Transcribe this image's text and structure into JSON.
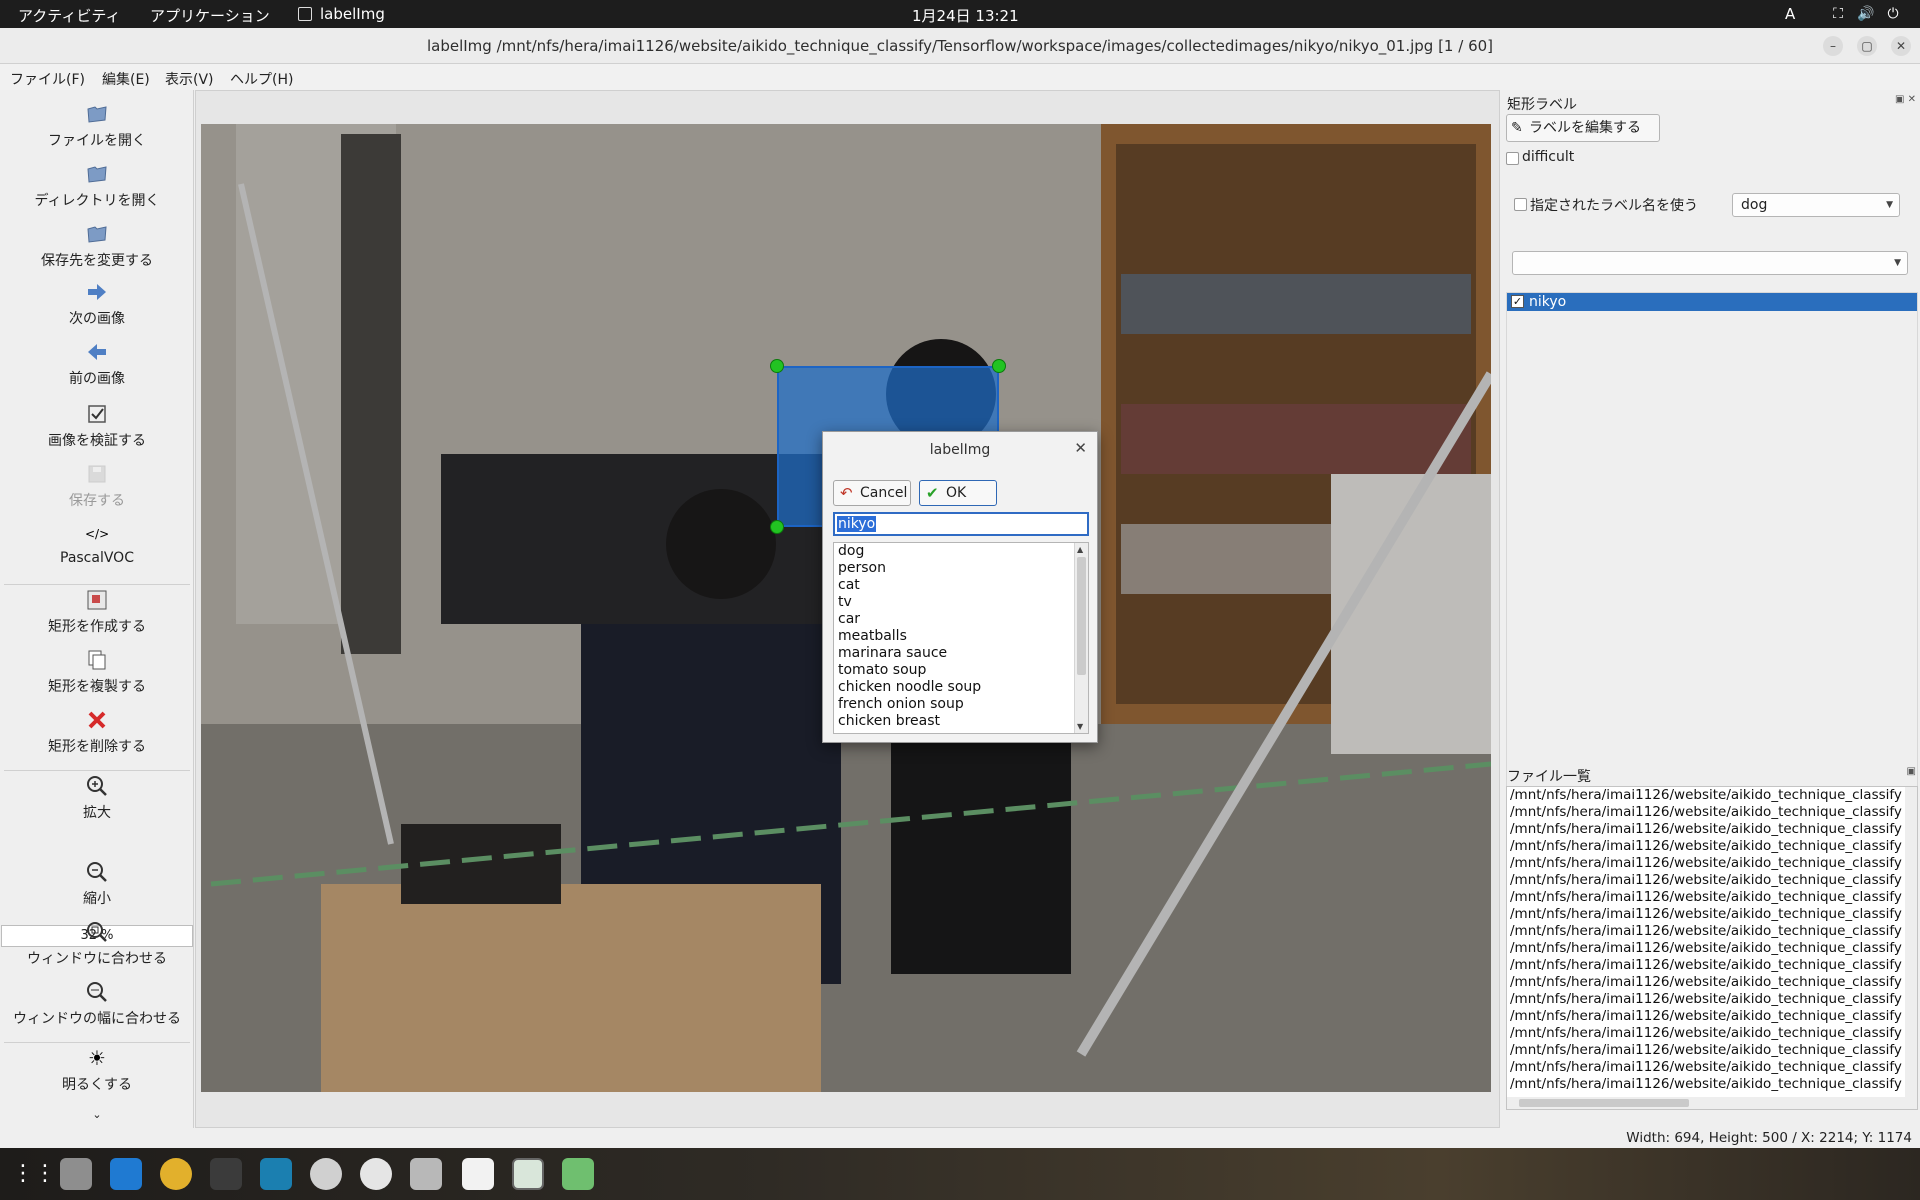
{
  "topbar": {
    "activities": "アクティビティ",
    "applications": "アプリケーション",
    "app_name": "labelImg",
    "clock": "1月24日  13:21",
    "input_method": "A"
  },
  "window": {
    "title": "labelImg /mnt/nfs/hera/imai1126/website/aikido_technique_classify/Tensorflow/workspace/images/collectedimages/nikyo/nikyo_01.jpg [1 / 60]"
  },
  "menu": {
    "file": "ファイル(F)",
    "edit": "編集(E)",
    "view": "表示(V)",
    "help": "ヘルプ(H)"
  },
  "toolbar": {
    "open_file": "ファイルを開く",
    "open_dir": "ディレクトリを開く",
    "change_save_dir": "保存先を変更する",
    "next_image": "次の画像",
    "prev_image": "前の画像",
    "verify_image": "画像を検証する",
    "save": "保存する",
    "format": "PascalVOC",
    "create_rect": "矩形を作成する",
    "duplicate_rect": "矩形を複製する",
    "delete_rect": "矩形を削除する",
    "zoom_in": "拡大",
    "zoom_level": "32 %",
    "zoom_out": "縮小",
    "fit_window": "ウィンドウに合わせる",
    "fit_width": "ウィンドウの幅に合わせる",
    "brighten": "明るくする",
    "more": "⌄"
  },
  "dialog": {
    "title": "labelImg",
    "cancel": "Cancel",
    "ok": "OK",
    "input_value": "nikyo",
    "options": [
      "dog",
      "person",
      "cat",
      "tv",
      "car",
      "meatballs",
      "marinara sauce",
      "tomato soup",
      "chicken noodle soup",
      "french onion soup",
      "chicken breast"
    ]
  },
  "dock": {
    "box_labels_title": "矩形ラベル",
    "edit_label": "ラベルを編集する",
    "difficult": "difficult",
    "use_default_label": "指定されたラベル名を使う",
    "default_label_value": "dog",
    "labels": [
      {
        "name": "nikyo",
        "checked": true
      }
    ],
    "file_list_title": "ファイル一覧",
    "files": [
      "/mnt/nfs/hera/imai1126/website/aikido_technique_classify",
      "/mnt/nfs/hera/imai1126/website/aikido_technique_classify",
      "/mnt/nfs/hera/imai1126/website/aikido_technique_classify",
      "/mnt/nfs/hera/imai1126/website/aikido_technique_classify",
      "/mnt/nfs/hera/imai1126/website/aikido_technique_classify",
      "/mnt/nfs/hera/imai1126/website/aikido_technique_classify",
      "/mnt/nfs/hera/imai1126/website/aikido_technique_classify",
      "/mnt/nfs/hera/imai1126/website/aikido_technique_classify",
      "/mnt/nfs/hera/imai1126/website/aikido_technique_classify",
      "/mnt/nfs/hera/imai1126/website/aikido_technique_classify",
      "/mnt/nfs/hera/imai1126/website/aikido_technique_classify",
      "/mnt/nfs/hera/imai1126/website/aikido_technique_classify",
      "/mnt/nfs/hera/imai1126/website/aikido_technique_classify",
      "/mnt/nfs/hera/imai1126/website/aikido_technique_classify",
      "/mnt/nfs/hera/imai1126/website/aikido_technique_classify",
      "/mnt/nfs/hera/imai1126/website/aikido_technique_classify",
      "/mnt/nfs/hera/imai1126/website/aikido_technique_classify",
      "/mnt/nfs/hera/imai1126/website/aikido_technique_classify"
    ]
  },
  "status": {
    "text": "Width: 694, Height: 500 / X: 2214; Y: 1174"
  },
  "colors": {
    "selection": "#2a6ebd",
    "bbox_fill": "#1e6ec8",
    "handle": "#22c322",
    "topbar": "#1d1d1d"
  }
}
